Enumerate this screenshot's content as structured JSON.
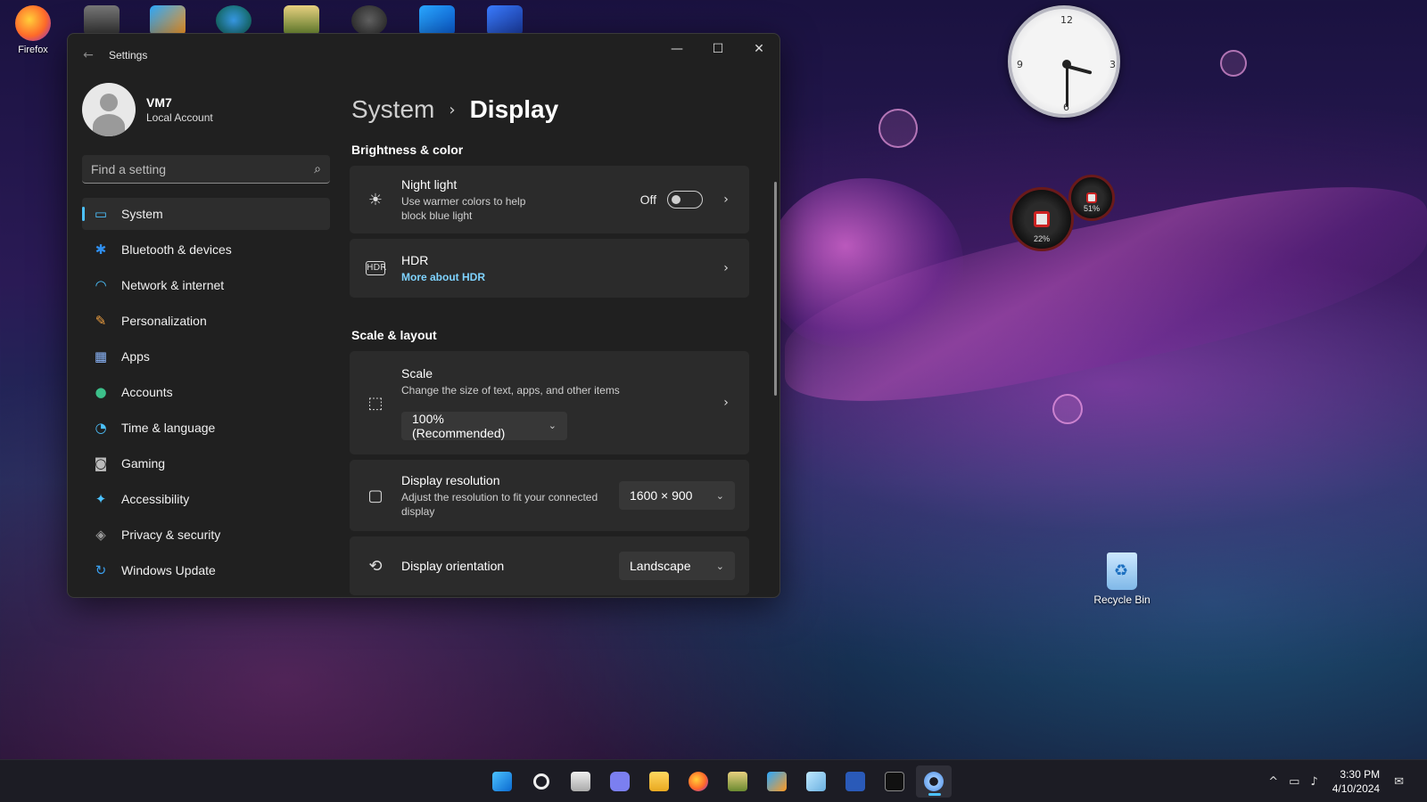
{
  "desktop": {
    "firefox_label": "Firefox",
    "recycle_label": "Recycle Bin",
    "clock_numbers": {
      "n12": "12",
      "n3": "3",
      "n6": "6",
      "n9": "9"
    },
    "meter_small": "51%",
    "meter_large": "22%"
  },
  "window": {
    "title": "Settings",
    "back_icon": "←",
    "minimize_icon": "—",
    "maximize_icon": "☐",
    "close_icon": "✕"
  },
  "profile": {
    "name": "VM7",
    "subtitle": "Local Account"
  },
  "search": {
    "placeholder": "Find a setting",
    "icon": "⌕"
  },
  "sidebar": {
    "items": [
      {
        "label": "System",
        "icon": "▭",
        "color": "#4cc2ff"
      },
      {
        "label": "Bluetooth & devices",
        "icon": "✱",
        "color": "#2f8ff0"
      },
      {
        "label": "Network & internet",
        "icon": "◠",
        "color": "#4cc2ff"
      },
      {
        "label": "Personalization",
        "icon": "✎",
        "color": "#f0a040"
      },
      {
        "label": "Apps",
        "icon": "▦",
        "color": "#8ab4f8"
      },
      {
        "label": "Accounts",
        "icon": "●",
        "color": "#3cc08a"
      },
      {
        "label": "Time & language",
        "icon": "◔",
        "color": "#4cc2ff"
      },
      {
        "label": "Gaming",
        "icon": "◙",
        "color": "#bbbbbb"
      },
      {
        "label": "Accessibility",
        "icon": "✦",
        "color": "#4cc2ff"
      },
      {
        "label": "Privacy & security",
        "icon": "◈",
        "color": "#9a9a9a"
      },
      {
        "label": "Windows Update",
        "icon": "↻",
        "color": "#3aa0f0"
      }
    ]
  },
  "content": {
    "breadcrumb_parent": "System",
    "breadcrumb_sep": "›",
    "breadcrumb_current": "Display",
    "section_brightness": "Brightness & color",
    "night_light": {
      "title": "Night light",
      "subtitle": "Use warmer colors to help block blue light",
      "toggle_state": "Off",
      "icon": "☀",
      "chevron": "›"
    },
    "hdr": {
      "title": "HDR",
      "link": "More about HDR",
      "icon": "HDR",
      "chevron": "›"
    },
    "section_scale": "Scale & layout",
    "scale": {
      "title": "Scale",
      "subtitle": "Change the size of text, apps, and other items",
      "value": "100% (Recommended)",
      "icon": "⬚",
      "chevron": "›",
      "dd_chevron": "⌄"
    },
    "resolution": {
      "title": "Display resolution",
      "subtitle": "Adjust the resolution to fit your connected display",
      "value": "1600 × 900",
      "icon": "▢",
      "dd_chevron": "⌄"
    },
    "orientation": {
      "title": "Display orientation",
      "value": "Landscape",
      "icon": "⟲",
      "dd_chevron": "⌄"
    }
  },
  "taskbar": {
    "time": "3:30 PM",
    "date": "4/10/2024",
    "tray_chevron": "^",
    "network_icon": "▭",
    "volume_icon": "♪",
    "notification_icon": "✉"
  }
}
